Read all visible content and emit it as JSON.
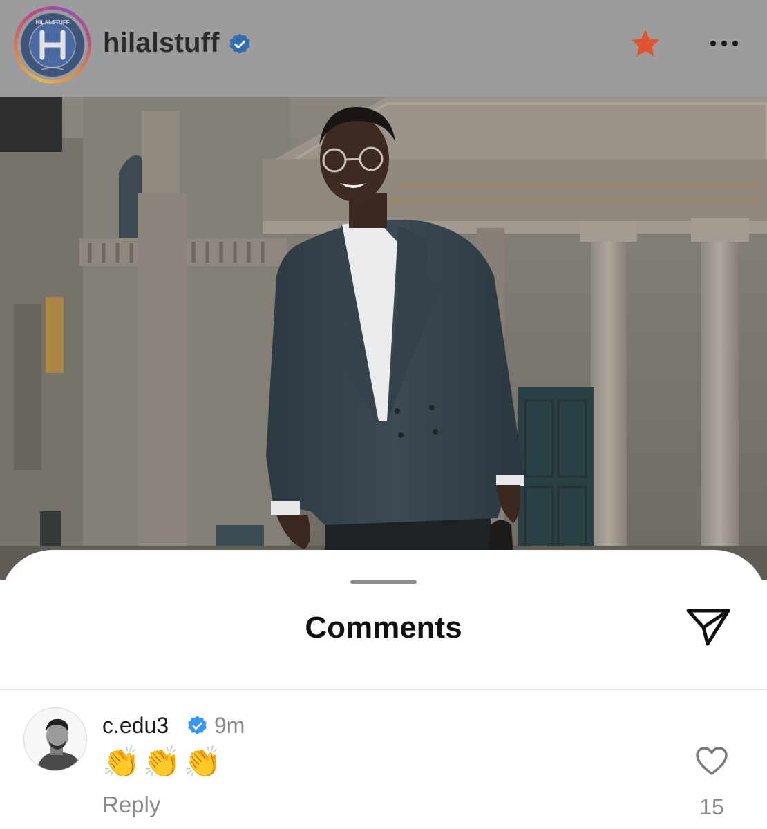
{
  "header": {
    "username": "hilalstuff",
    "verified": true,
    "avatar_icon": "al-hilal-club-logo",
    "logo_text": "HILALSTUFF",
    "favorite_icon": "star-icon",
    "more_icon": "more-horizontal-icon",
    "colors": {
      "bar": "#9c9c9c",
      "star": "#e0542f"
    }
  },
  "post": {
    "image": "man-in-double-breasted-suit-in-front-of-neoclassical-building-photo"
  },
  "comments_sheet": {
    "title": "Comments",
    "share_icon": "send-icon",
    "comments": [
      {
        "username": "c.edu3",
        "verified": true,
        "time": "9m",
        "text": "👏👏👏",
        "reply_label": "Reply",
        "like_icon": "heart-icon",
        "like_count": "15"
      }
    ]
  },
  "colors": {
    "verified_badge": "#3897f0",
    "muted_text": "#8a8a8a"
  }
}
